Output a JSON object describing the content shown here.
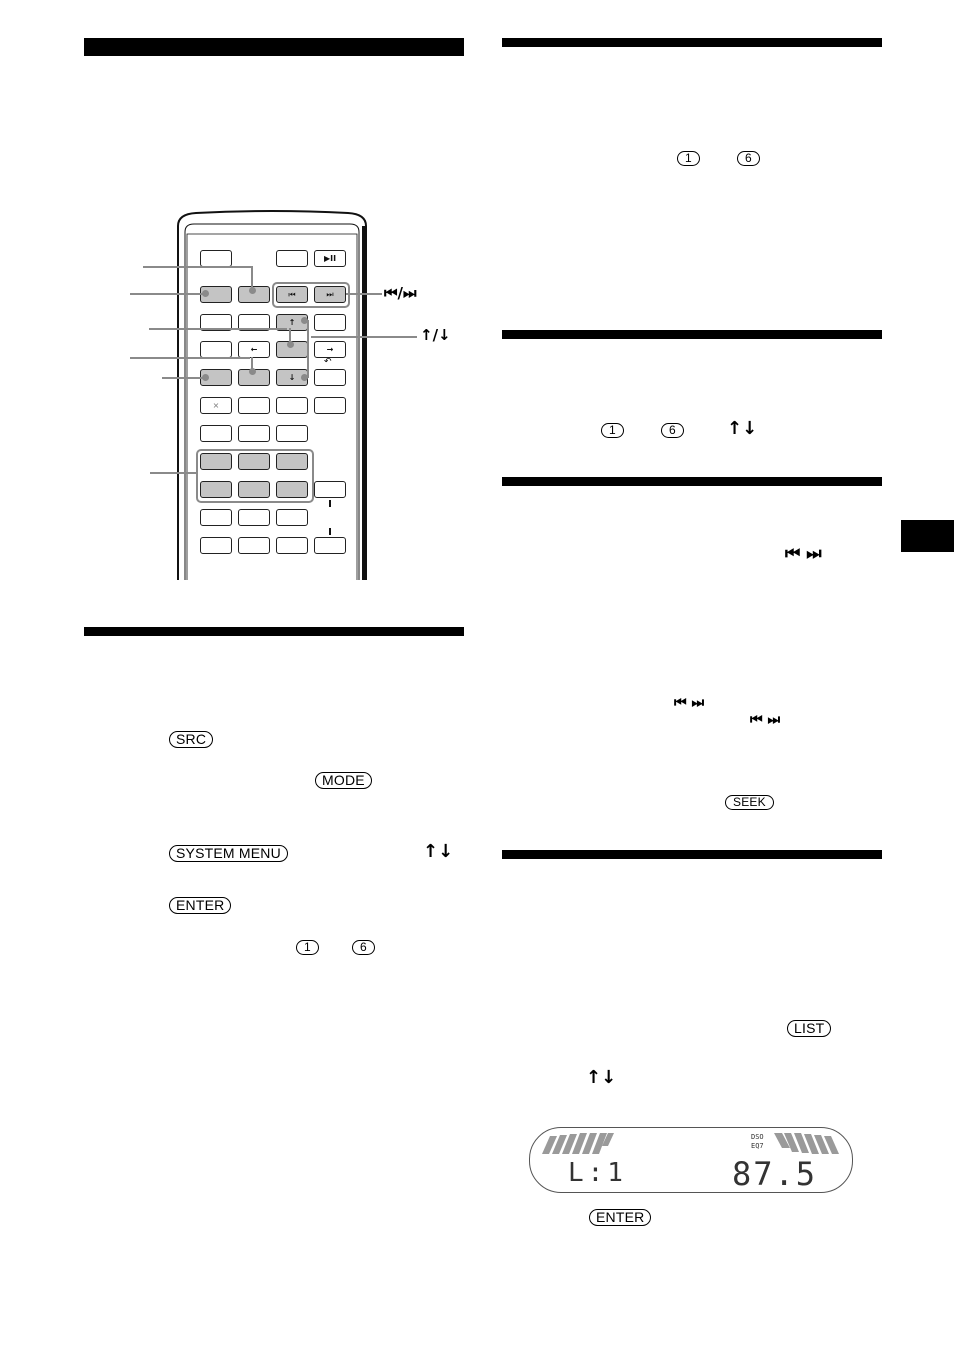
{
  "page": {
    "section_bars": [
      {
        "name": "left-heading-1"
      },
      {
        "name": "right-heading-1"
      },
      {
        "name": "right-heading-2"
      },
      {
        "name": "right-heading-3"
      },
      {
        "name": "left-heading-2"
      },
      {
        "name": "right-heading-4"
      }
    ],
    "thumb_tab": {
      "color": "#000000"
    }
  },
  "remote_figure": {
    "callout_labels": {
      "prev_next": "⏮/⏭",
      "up_down": "↑/↓"
    },
    "buttons": {
      "play_pause": "▶II",
      "prev": "⏮",
      "next": "⏭",
      "up": "↑",
      "down": "↓",
      "left": "←",
      "right": "→",
      "mute": "×",
      "return_symbol": "↶"
    },
    "highlight_color": "#c4c4c4",
    "callout_color": "#8a8a8a"
  },
  "top_right": {
    "keys": [
      "1",
      "6"
    ]
  },
  "right_section_2": {
    "keys": [
      "1",
      "6"
    ],
    "arrows": "↑↓"
  },
  "right_section_3": {
    "skip_symbols": "⏮ ⏭",
    "skip_symbols_2": "⏮ ⏭",
    "skip_symbols_3": "⏮ ⏭",
    "seek_key": "SEEK"
  },
  "left_section_2": {
    "src_key": "SRC",
    "mode_key": "MODE",
    "system_menu_key": "SYSTEM MENU",
    "arrows": "↑↓",
    "enter_key": "ENTER",
    "keys": [
      "1",
      "6"
    ]
  },
  "right_section_4": {
    "list_key": "LIST",
    "arrows": "↑↓",
    "enter_key": "ENTER",
    "display": {
      "indicator_1": "DSO",
      "indicator_2": "EQ7",
      "left_text": "L:1",
      "frequency": "87.5"
    }
  }
}
